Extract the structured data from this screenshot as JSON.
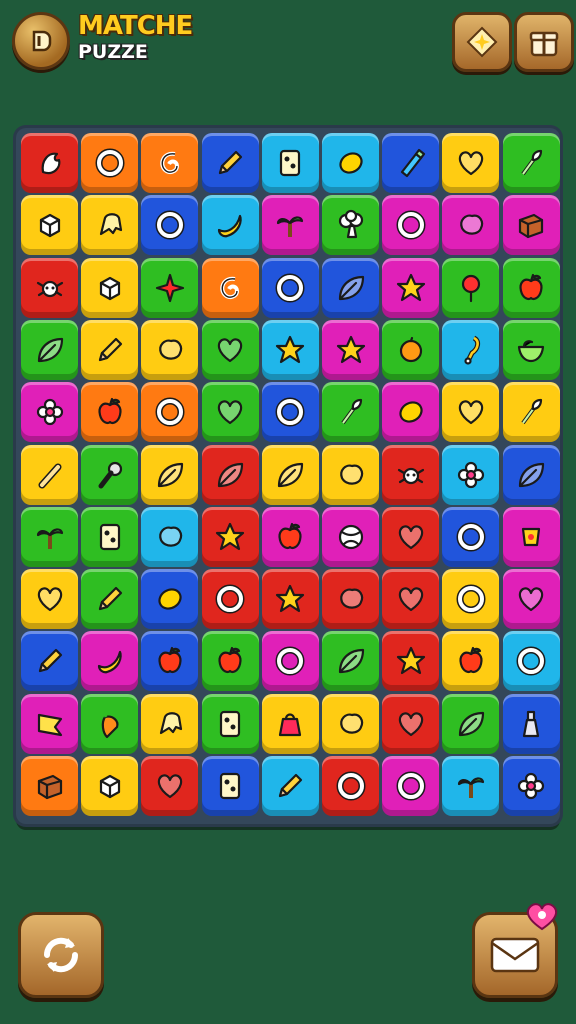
{
  "header": {
    "title_line1": "MATCHE",
    "title_line2": "PUZZE",
    "logo_icon": "logo-emblem-icon",
    "hint_icon": "hint-star-icon",
    "gift_icon": "gift-box-icon"
  },
  "controls": {
    "shuffle_icon": "shuffle-arrows-icon",
    "powerup_icon": "powerup-envelope-icon",
    "powerup_badge_icon": "heart-badge-icon"
  },
  "board": {
    "rows": 11,
    "cols": 9,
    "colors": {
      "red": "#e0261e",
      "orange": "#ff7a12",
      "yellow": "#ffcc12",
      "green": "#2fbe22",
      "cyan": "#20b6ea",
      "blue": "#2155dc",
      "magenta": "#e020b8",
      "purple": "#8a2bd6"
    },
    "tiles": [
      [
        [
          "red",
          "claw"
        ],
        [
          "orange",
          "ring"
        ],
        [
          "orange",
          "swirl"
        ],
        [
          "blue",
          "pencil"
        ],
        [
          "cyan",
          "card"
        ],
        [
          "cyan",
          "lemon"
        ],
        [
          "blue",
          "marker"
        ],
        [
          "yellow",
          "heart"
        ],
        [
          "green",
          "brush"
        ]
      ],
      [
        [
          "yellow",
          "cube"
        ],
        [
          "yellow",
          "ghost"
        ],
        [
          "blue",
          "ring"
        ],
        [
          "cyan",
          "banana"
        ],
        [
          "magenta",
          "palm"
        ],
        [
          "green",
          "tree"
        ],
        [
          "magenta",
          "ring"
        ],
        [
          "magenta",
          "blob"
        ],
        [
          "magenta",
          "box"
        ]
      ],
      [
        [
          "red",
          "crab"
        ],
        [
          "yellow",
          "cube"
        ],
        [
          "green",
          "star4"
        ],
        [
          "orange",
          "swirl"
        ],
        [
          "blue",
          "ring"
        ],
        [
          "blue",
          "leaf"
        ],
        [
          "magenta",
          "star"
        ],
        [
          "green",
          "pin"
        ],
        [
          "green",
          "apple"
        ]
      ],
      [
        [
          "green",
          "leaf"
        ],
        [
          "yellow",
          "pencil"
        ],
        [
          "yellow",
          "blob"
        ],
        [
          "green",
          "heart"
        ],
        [
          "cyan",
          "star"
        ],
        [
          "magenta",
          "star"
        ],
        [
          "green",
          "orange"
        ],
        [
          "cyan",
          "hook"
        ],
        [
          "green",
          "bowl"
        ]
      ],
      [
        [
          "magenta",
          "flower"
        ],
        [
          "orange",
          "apple"
        ],
        [
          "orange",
          "ring"
        ],
        [
          "green",
          "heart"
        ],
        [
          "blue",
          "ring"
        ],
        [
          "green",
          "brush"
        ],
        [
          "magenta",
          "lemon"
        ],
        [
          "yellow",
          "heart"
        ],
        [
          "yellow",
          "brush"
        ]
      ],
      [
        [
          "yellow",
          "bone"
        ],
        [
          "green",
          "mic"
        ],
        [
          "yellow",
          "leaf"
        ],
        [
          "red",
          "leaf"
        ],
        [
          "yellow",
          "leaf"
        ],
        [
          "yellow",
          "blob"
        ],
        [
          "red",
          "crab"
        ],
        [
          "cyan",
          "flower"
        ],
        [
          "blue",
          "leaf"
        ]
      ],
      [
        [
          "green",
          "palm"
        ],
        [
          "green",
          "card"
        ],
        [
          "cyan",
          "blob"
        ],
        [
          "red",
          "star"
        ],
        [
          "magenta",
          "apple"
        ],
        [
          "magenta",
          "ball"
        ],
        [
          "red",
          "heart"
        ],
        [
          "blue",
          "ring"
        ],
        [
          "magenta",
          "cup"
        ]
      ],
      [
        [
          "yellow",
          "heart"
        ],
        [
          "green",
          "pencil"
        ],
        [
          "blue",
          "lemon"
        ],
        [
          "red",
          "ring"
        ],
        [
          "red",
          "star"
        ],
        [
          "red",
          "blob"
        ],
        [
          "red",
          "heart"
        ],
        [
          "yellow",
          "ring"
        ],
        [
          "magenta",
          "heart"
        ]
      ],
      [
        [
          "blue",
          "pencil"
        ],
        [
          "magenta",
          "banana"
        ],
        [
          "blue",
          "apple"
        ],
        [
          "green",
          "apple"
        ],
        [
          "magenta",
          "ring"
        ],
        [
          "green",
          "leaf"
        ],
        [
          "red",
          "star"
        ],
        [
          "yellow",
          "apple"
        ],
        [
          "cyan",
          "ring"
        ]
      ],
      [
        [
          "magenta",
          "flag"
        ],
        [
          "green",
          "carrot"
        ],
        [
          "yellow",
          "ghost"
        ],
        [
          "green",
          "card"
        ],
        [
          "yellow",
          "bag"
        ],
        [
          "yellow",
          "blob"
        ],
        [
          "red",
          "heart"
        ],
        [
          "green",
          "leaf"
        ],
        [
          "blue",
          "bottle"
        ]
      ],
      [
        [
          "orange",
          "box"
        ],
        [
          "yellow",
          "cube"
        ],
        [
          "red",
          "heart"
        ],
        [
          "blue",
          "card"
        ],
        [
          "cyan",
          "pencil"
        ],
        [
          "red",
          "ring"
        ],
        [
          "magenta",
          "ring"
        ],
        [
          "cyan",
          "palm"
        ],
        [
          "blue",
          "flower"
        ]
      ]
    ]
  }
}
